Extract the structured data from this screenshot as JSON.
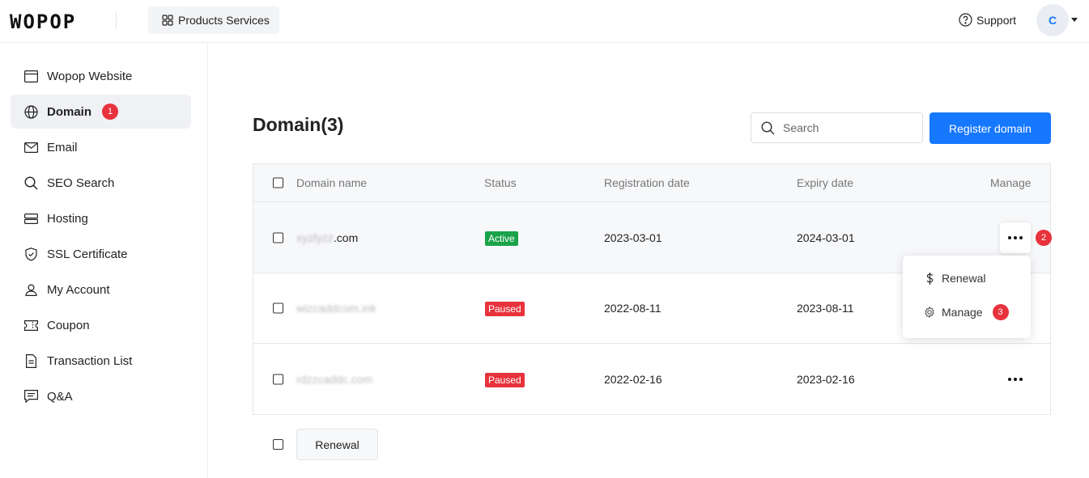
{
  "header": {
    "logo": "WOPOP",
    "products_label": "Products Services",
    "support_label": "Support",
    "avatar_initial": "C"
  },
  "sidebar": {
    "items": [
      {
        "label": "Wopop Website",
        "icon": "browser-window-icon"
      },
      {
        "label": "Domain",
        "icon": "globe-icon",
        "badge": "1"
      },
      {
        "label": "Email",
        "icon": "envelope-icon"
      },
      {
        "label": "SEO Search",
        "icon": "magnifier-icon"
      },
      {
        "label": "Hosting",
        "icon": "server-icon"
      },
      {
        "label": "SSL Certificate",
        "icon": "shield-check-icon"
      },
      {
        "label": "My Account",
        "icon": "user-icon"
      },
      {
        "label": "Coupon",
        "icon": "ticket-icon"
      },
      {
        "label": "Transaction List",
        "icon": "document-icon"
      },
      {
        "label": "Q&A",
        "icon": "chat-icon"
      }
    ]
  },
  "main": {
    "title": "Domain(3)",
    "search_placeholder": "Search",
    "register_label": "Register domain",
    "columns": [
      "Domain name",
      "Status",
      "Registration date",
      "Expiry date",
      "Manage"
    ],
    "rows": [
      {
        "domain": "xyzfyzz.com",
        "status": "Active",
        "registered": "2023-03-01",
        "expiry": "2024-03-01",
        "step_badge": "2"
      },
      {
        "domain": "wizcaddcom.ink",
        "status": "Paused",
        "registered": "2022-08-11",
        "expiry": "2023-08-11"
      },
      {
        "domain": "rdzzcaddc.com",
        "status": "Paused",
        "registered": "2022-02-16",
        "expiry": "2023-02-16"
      }
    ],
    "dropdown": {
      "renewal": "Renewal",
      "manage": "Manage",
      "manage_badge": "3"
    },
    "bottom_renewal_label": "Renewal"
  },
  "colors": {
    "primary": "#1677ff",
    "active": "#1aa34a",
    "paused": "#e8323c",
    "badge": "#e8323c"
  }
}
